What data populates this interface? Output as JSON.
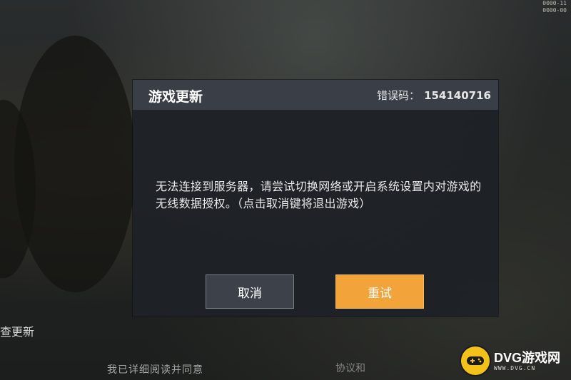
{
  "top_right_info": [
    "0000-11",
    "0000-00"
  ],
  "left_caption": "查更新",
  "bottom_text": "我已详细阅读并同意",
  "bottom_text_2": "协议和",
  "dialog": {
    "title": "游戏更新",
    "error_label": "错误码：",
    "error_code": "154140716",
    "message": "无法连接到服务器，请尝试切换网络或开启系统设置内对游戏的无线数据授权。（点击取消键将退出游戏）",
    "cancel_label": "取消",
    "retry_label": "重试"
  },
  "watermark": {
    "main": "DVG游戏网",
    "sub": "WWW.DVG.CN"
  },
  "colors": {
    "retry_button": "#f2a43a",
    "cancel_button": "#3c414a",
    "dialog_header": "#3a3e46",
    "logo_badge": "#f2c21b"
  }
}
